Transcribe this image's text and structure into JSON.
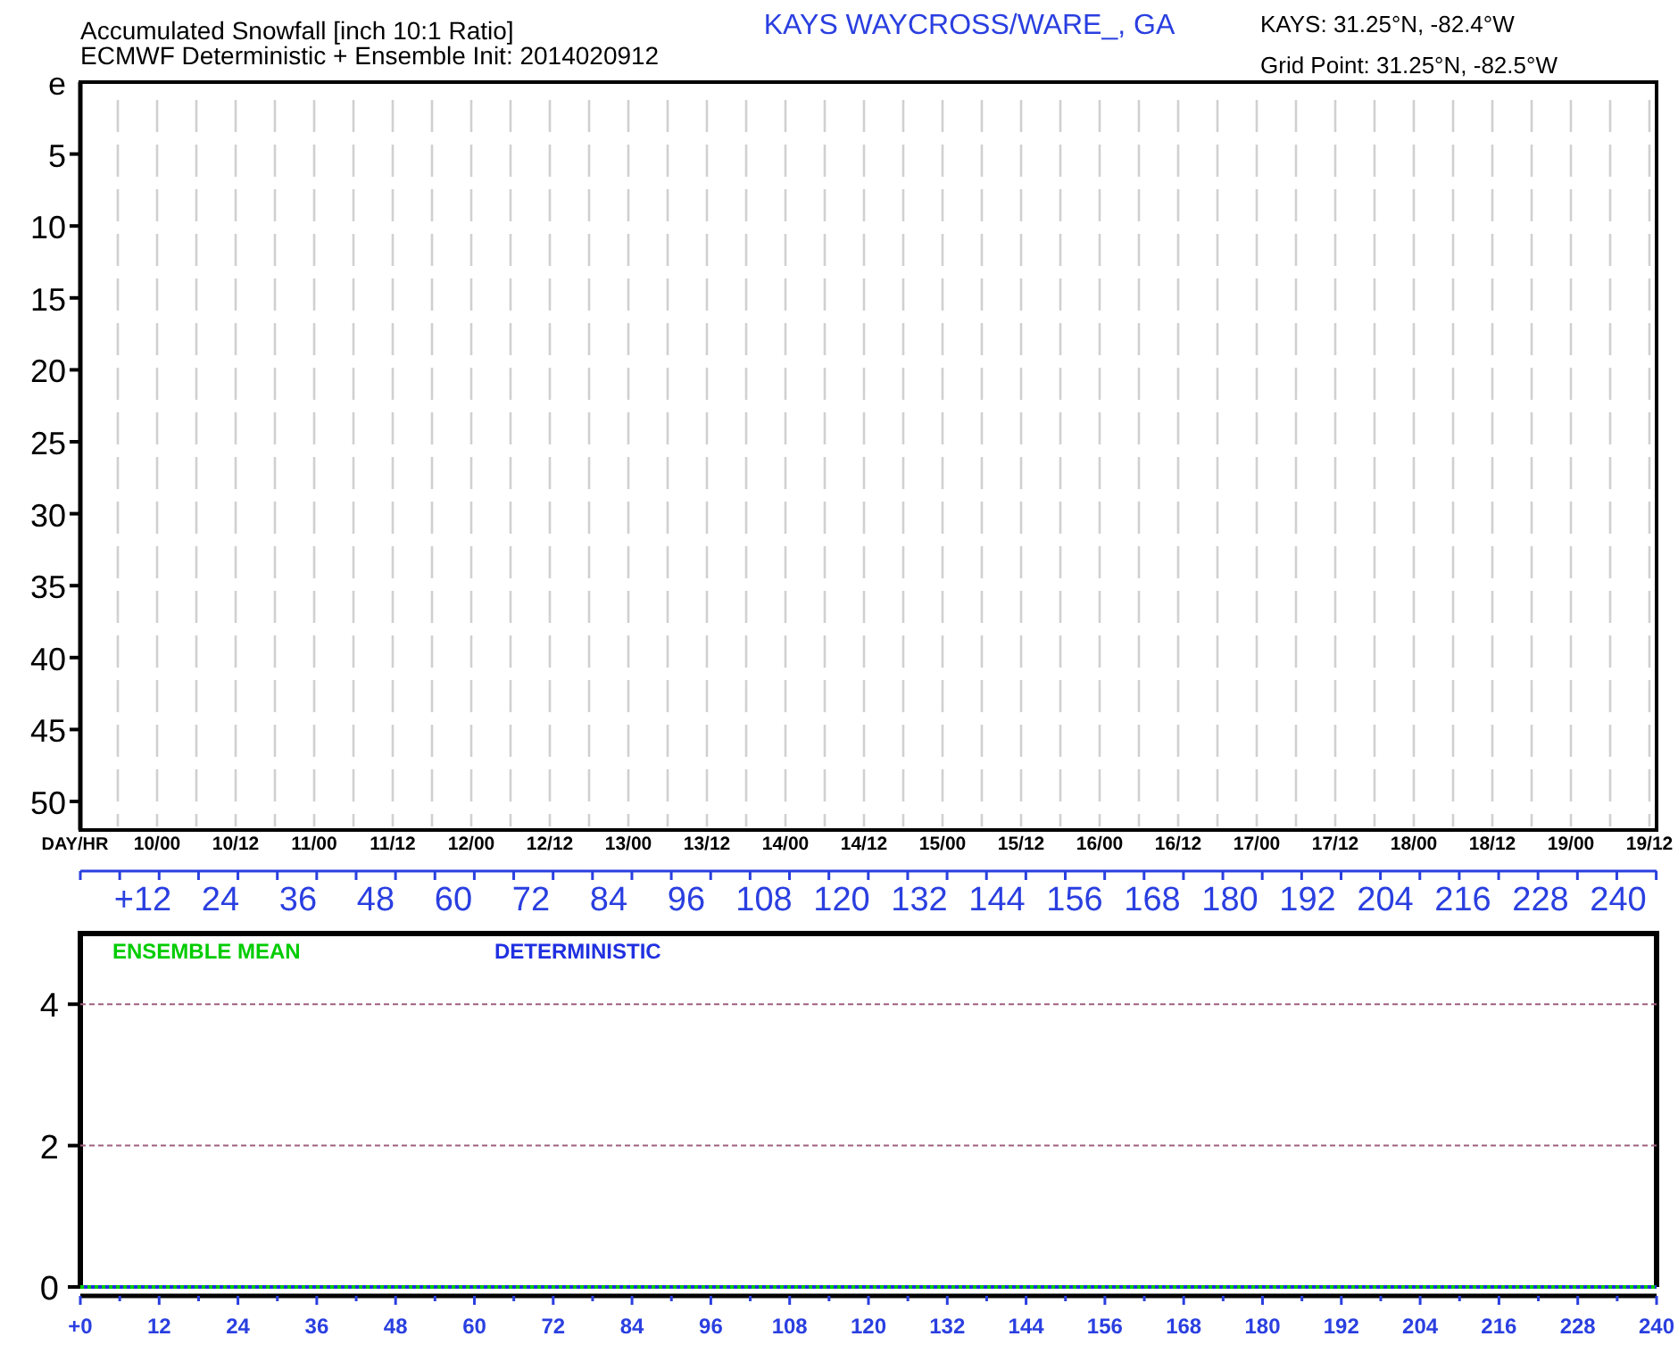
{
  "header": {
    "title": "Accumulated Snowfall [inch 10:1 Ratio]",
    "subtitle": "ECMWF Deterministic + Ensemble Init: 2014020912",
    "station": "KAYS WAYCROSS/WARE_, GA",
    "station_coords": "KAYS: 31.25°N, -82.4°W",
    "grid_point": "Grid Point: 31.25°N, -82.5°W"
  },
  "plume_panel": {
    "corner_label": "e",
    "y_labels": [
      "5",
      "10",
      "15",
      "20",
      "25",
      "30",
      "35",
      "40",
      "45",
      "50"
    ],
    "day_hr_label": "DAY/HR",
    "day_labels": [
      "10/00",
      "10/12",
      "11/00",
      "11/12",
      "12/00",
      "12/12",
      "13/00",
      "13/12",
      "14/00",
      "14/12",
      "15/00",
      "15/12",
      "16/00",
      "16/12",
      "17/00",
      "17/12",
      "18/00",
      "18/12",
      "19/00",
      "19/12"
    ],
    "hour_labels": [
      "+12",
      "24",
      "36",
      "48",
      "60",
      "72",
      "84",
      "96",
      "108",
      "120",
      "132",
      "144",
      "156",
      "168",
      "180",
      "192",
      "204",
      "216",
      "228",
      "240"
    ]
  },
  "snowfall_chart": {
    "chart_data": {
      "type": "line",
      "categories": [
        "+0",
        "12",
        "24",
        "36",
        "48",
        "60",
        "72",
        "84",
        "96",
        "108",
        "120",
        "132",
        "144",
        "156",
        "168",
        "180",
        "192",
        "204",
        "216",
        "228",
        "240"
      ],
      "ylim": [
        0,
        5
      ],
      "yticks": [
        0,
        2,
        4
      ],
      "series": [
        {
          "name": "ENSEMBLE MEAN",
          "color": "#00cc00",
          "line_style": "dotted",
          "values": [
            0,
            0,
            0,
            0,
            0,
            0,
            0,
            0,
            0,
            0,
            0,
            0,
            0,
            0,
            0,
            0,
            0,
            0,
            0,
            0,
            0
          ]
        },
        {
          "name": "DETERMINISTIC",
          "color": "#2030e0",
          "line_style": "dotted",
          "values": [
            0,
            0,
            0,
            0,
            0,
            0,
            0,
            0,
            0,
            0,
            0,
            0,
            0,
            0,
            0,
            0,
            0,
            0,
            0,
            0,
            0
          ]
        }
      ]
    }
  }
}
